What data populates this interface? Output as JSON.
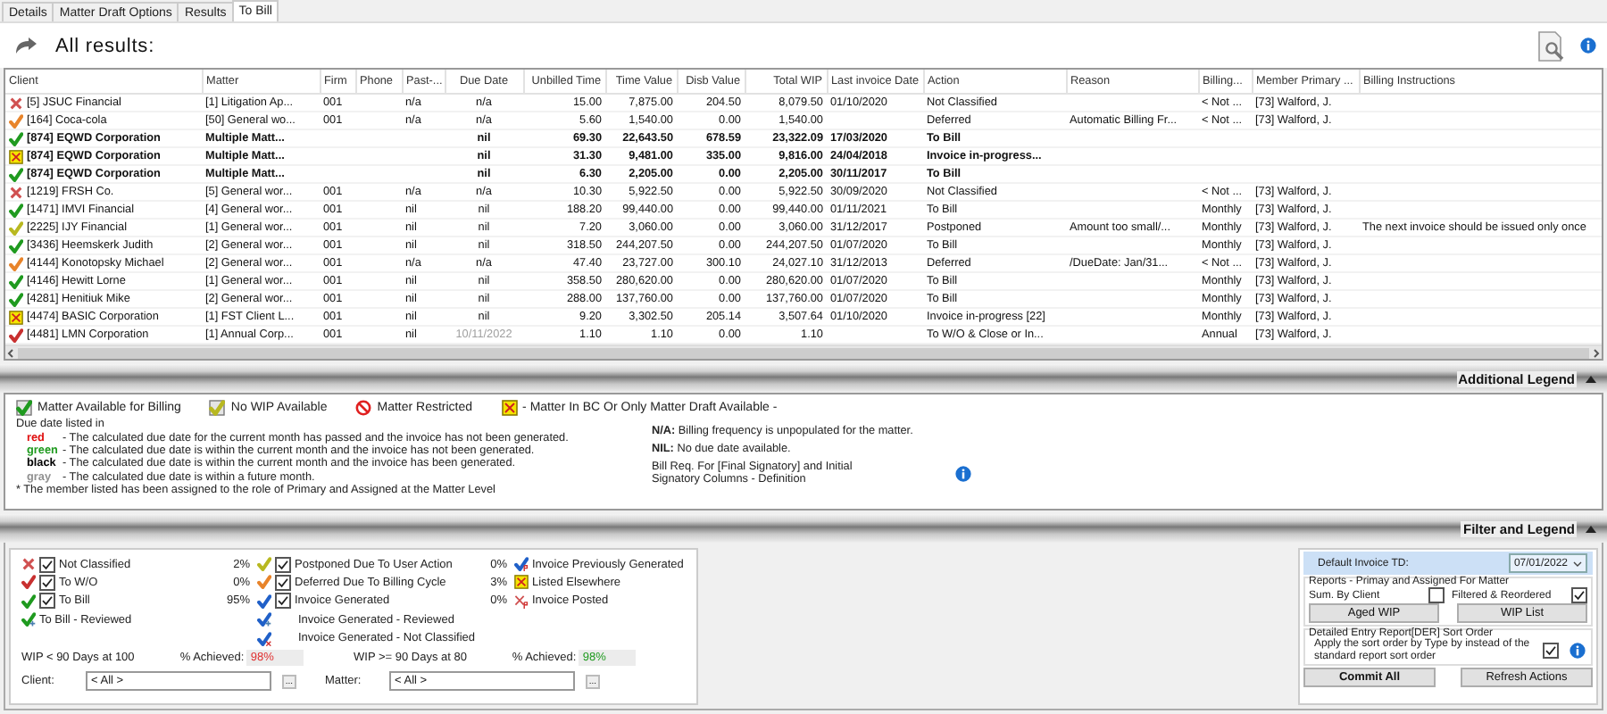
{
  "tabs": [
    {
      "label": "Details",
      "selected": false
    },
    {
      "label": "Matter Draft Options",
      "selected": false
    },
    {
      "label": "Results",
      "selected": false
    },
    {
      "label": "To Bill",
      "selected": true
    }
  ],
  "header": {
    "title": "All results:"
  },
  "table": {
    "columns": [
      "Client",
      "Matter",
      "Firm",
      "Phone",
      "Past-...",
      "Due Date",
      "Unbilled Time",
      "Time Value",
      "Disb Value",
      "Total WIP",
      "Last invoice Date",
      "Action",
      "Reason",
      "Billing...",
      "Member Primary ...",
      "Billing Instructions"
    ],
    "rows": [
      {
        "symbol": {
          "kind": "cross",
          "color": "#d05050"
        },
        "bold": false,
        "due_future": false,
        "cells": [
          "[5] JSUC Financial",
          "[1] Litigation Ap...",
          "001",
          null,
          "n/a",
          "n/a",
          "15.00",
          "7,875.00",
          "204.50",
          "8,079.50",
          "01/10/2020",
          "Not Classified",
          null,
          "< Not ...",
          "[73] Walford, J.",
          null
        ]
      },
      {
        "symbol": {
          "kind": "check",
          "color": "#e8842a"
        },
        "bold": false,
        "due_future": false,
        "cells": [
          "[164] Coca-cola",
          "[50] General wo...",
          "001",
          null,
          "n/a",
          "n/a",
          "5.60",
          "1,540.00",
          "0.00",
          "1,540.00",
          null,
          "Deferred",
          "Automatic Billing Fr...",
          "< Not ...",
          "[73] Walford, J.",
          null
        ]
      },
      {
        "symbol": {
          "kind": "check",
          "color": "#1f9a1f"
        },
        "bold": true,
        "due_future": false,
        "cells": [
          "[874] EQWD Corporation",
          "Multiple Matt...",
          null,
          null,
          null,
          "nil",
          "69.30",
          "22,643.50",
          "678.59",
          "23,322.09",
          "17/03/2020",
          "To Bill",
          null,
          null,
          null,
          null
        ]
      },
      {
        "symbol": {
          "kind": "boxed-cross",
          "color": "#f5e400"
        },
        "bold": true,
        "due_future": false,
        "cells": [
          "[874] EQWD Corporation",
          "Multiple Matt...",
          null,
          null,
          null,
          "nil",
          "31.30",
          "9,481.00",
          "335.00",
          "9,816.00",
          "24/04/2018",
          "Invoice in-progress...",
          null,
          null,
          null,
          null
        ]
      },
      {
        "symbol": {
          "kind": "check",
          "color": "#1f9a1f"
        },
        "bold": true,
        "due_future": false,
        "cells": [
          "[874] EQWD Corporation",
          "Multiple Matt...",
          null,
          null,
          null,
          "nil",
          "6.30",
          "2,205.00",
          "0.00",
          "2,205.00",
          "30/11/2017",
          "To Bill",
          null,
          null,
          null,
          null
        ]
      },
      {
        "symbol": {
          "kind": "cross",
          "color": "#d05050"
        },
        "bold": false,
        "due_future": false,
        "cells": [
          "[1219] FRSH Co.",
          "[5] General wor...",
          "001",
          null,
          "n/a",
          "n/a",
          "10.30",
          "5,922.50",
          "0.00",
          "5,922.50",
          "30/09/2020",
          "Not Classified",
          null,
          "< Not ...",
          "[73] Walford, J.",
          null
        ]
      },
      {
        "symbol": {
          "kind": "check",
          "color": "#1f9a1f"
        },
        "bold": false,
        "due_future": false,
        "cells": [
          "[1471] IMVI Financial",
          "[4] General wor...",
          "001",
          null,
          "nil",
          "nil",
          "188.20",
          "99,440.00",
          "0.00",
          "99,440.00",
          "01/11/2021",
          "To Bill",
          null,
          "Monthly",
          "[73] Walford, J.",
          null
        ]
      },
      {
        "symbol": {
          "kind": "check",
          "color": "#b8b820"
        },
        "bold": false,
        "due_future": false,
        "cells": [
          "[2225] IJY Financial",
          "[1] General wor...",
          "001",
          null,
          "nil",
          "nil",
          "7.20",
          "3,060.00",
          "0.00",
          "3,060.00",
          "31/12/2017",
          "Postponed",
          "Amount too small/...",
          "Monthly",
          "[73] Walford, J.",
          "The next invoice should be issued only once"
        ]
      },
      {
        "symbol": {
          "kind": "check",
          "color": "#1f9a1f"
        },
        "bold": false,
        "due_future": false,
        "cells": [
          "[3436] Heemskerk Judith",
          "[2] General wor...",
          "001",
          null,
          "nil",
          "nil",
          "318.50",
          "244,207.50",
          "0.00",
          "244,207.50",
          "01/07/2020",
          "To Bill",
          null,
          "Monthly",
          "[73] Walford, J.",
          null
        ]
      },
      {
        "symbol": {
          "kind": "check",
          "color": "#e8842a"
        },
        "bold": false,
        "due_future": false,
        "cells": [
          "[4144] Konotopsky Michael",
          "[2] General wor...",
          "001",
          null,
          "n/a",
          "n/a",
          "47.40",
          "23,727.00",
          "300.10",
          "24,027.10",
          "31/12/2013",
          "Deferred",
          "/DueDate: Jan/31...",
          "< Not ...",
          "[73] Walford, J.",
          null
        ]
      },
      {
        "symbol": {
          "kind": "check",
          "color": "#1f9a1f"
        },
        "bold": false,
        "due_future": false,
        "cells": [
          "[4146] Hewitt Lorne",
          "[1] General wor...",
          "001",
          null,
          "nil",
          "nil",
          "358.50",
          "280,620.00",
          "0.00",
          "280,620.00",
          "01/07/2020",
          "To Bill",
          null,
          "Monthly",
          "[73] Walford, J.",
          null
        ]
      },
      {
        "symbol": {
          "kind": "check",
          "color": "#1f9a1f"
        },
        "bold": false,
        "due_future": false,
        "cells": [
          "[4281] Henitiuk Mike",
          "[2] General wor...",
          "001",
          null,
          "nil",
          "nil",
          "288.00",
          "137,760.00",
          "0.00",
          "137,760.00",
          "01/07/2020",
          "To Bill",
          null,
          "Monthly",
          "[73] Walford, J.",
          null
        ]
      },
      {
        "symbol": {
          "kind": "boxed-cross",
          "color": "#f5e400"
        },
        "bold": false,
        "due_future": false,
        "cells": [
          "[4474] BASIC Corporation",
          "[1] FST Client L...",
          "001",
          null,
          "nil",
          "nil",
          "9.20",
          "3,302.50",
          "205.14",
          "3,507.64",
          "01/10/2020",
          "Invoice in-progress [22]",
          null,
          "Monthly",
          "[73] Walford, J.",
          null
        ]
      },
      {
        "symbol": {
          "kind": "check",
          "color": "#c83030"
        },
        "bold": false,
        "due_future": true,
        "cells": [
          "[4481] LMN Corporation",
          "[1] Annual Corp...",
          "001",
          null,
          "nil",
          "10/11/2022",
          "1.10",
          "1.10",
          "0.00",
          "1.10",
          null,
          "To W/O & Close or In...",
          null,
          "Annual",
          "[73] Walford, J.",
          null
        ]
      }
    ]
  },
  "additional_legend": {
    "title": "Additional Legend",
    "symbols": [
      {
        "kind": "boxed-check",
        "color": "#1f9a1f",
        "label": "Matter Available for Billing"
      },
      {
        "kind": "boxed-check",
        "color": "#b8b820",
        "label": "No WIP Available"
      },
      {
        "kind": "no-entry",
        "color": "#e02020",
        "label": "Matter Restricted"
      },
      {
        "kind": "boxed-cross",
        "color": "#f5e400",
        "label": "- Matter In BC Or Only Matter Draft Available -"
      }
    ],
    "due_intro": "Due date listed in",
    "due_colors": [
      {
        "word": "red",
        "color": "#e01010",
        "text": "- The calculated due date for the current month has passed and the invoice has not been generated."
      },
      {
        "word": "green",
        "color": "#1f9a1f",
        "text": "- The calculated due date is within the current month and the invoice has not been generated."
      },
      {
        "word": "black",
        "color": "#000000",
        "text": "- The calculated due date is within the current month and the invoice has been generated."
      },
      {
        "word": "gray",
        "color": "#909090",
        "text": "- The calculated due date is within a future month."
      }
    ],
    "footnote": "* The member listed has been assigned to the role of Primary and Assigned  at the Matter Level",
    "notes": [
      "**N/A:** Billing frequency is unpopulated for the matter.",
      "**NIL:**  No due date available."
    ],
    "definition": "Bill Req. For [Final Signatory] and Initial Signatory Columns - Definition"
  },
  "filter_legend": {
    "title": "Filter and Legend",
    "status_columns": [
      [
        {
          "label": "Not Classified",
          "symbol": {
            "kind": "cross",
            "color": "#d05050"
          },
          "checkbox": {
            "checked": true
          },
          "pct": "2%"
        },
        {
          "label": "To W/O",
          "symbol": {
            "kind": "check",
            "color": "#c83030"
          },
          "checkbox": {
            "checked": true
          },
          "pct": "0%"
        },
        {
          "label": "To Bill",
          "symbol": {
            "kind": "check",
            "color": "#1f9a1f"
          },
          "checkbox": {
            "checked": true
          },
          "pct": "95%"
        },
        {
          "label": "To Bill - Reviewed",
          "symbol": {
            "kind": "check-plus",
            "color": "#1f9a1f"
          }
        }
      ],
      [
        {
          "label": "Postponed Due To User Action",
          "symbol": {
            "kind": "check",
            "color": "#b8b820"
          },
          "checkbox": {
            "checked": true
          },
          "pct": "0%"
        },
        {
          "label": "Deferred Due To Billing Cycle",
          "symbol": {
            "kind": "check",
            "color": "#e8842a"
          },
          "checkbox": {
            "checked": true
          },
          "pct": "3%"
        },
        {
          "label": "Invoice Generated",
          "symbol": {
            "kind": "check",
            "color": "#2060c8"
          },
          "checkbox": {
            "checked": true
          },
          "pct": "0%"
        },
        {
          "label": "Invoice Generated - Reviewed",
          "symbol": {
            "kind": "check-plus",
            "color": "#2060c8"
          }
        },
        {
          "label": "Invoice Generated - Not Classified",
          "symbol": {
            "kind": "check-x",
            "color": "#2060c8"
          }
        }
      ],
      [
        {
          "label": "Invoice Previously Generated",
          "symbol": {
            "kind": "check-badge",
            "color": "#2060c8"
          }
        },
        {
          "label": "Listed Elsewhere",
          "symbol": {
            "kind": "boxed-cross",
            "color": "#f5e400"
          }
        },
        {
          "label": "Invoice Posted",
          "symbol": {
            "kind": "cross-badge",
            "color": "#d05050"
          }
        }
      ]
    ],
    "targets": [
      {
        "label": "WIP < 90  Days at 100",
        "achieved_label": "% Achieved:",
        "achieved": "98%",
        "color": "#e03030"
      },
      {
        "label": "WIP >= 90  Days at 80",
        "achieved_label": "% Achieved:",
        "achieved": "98%",
        "color": "#1f9a1f"
      }
    ],
    "lookups": [
      {
        "label": "Client:",
        "value": "< All >",
        "button": "..."
      },
      {
        "label": "Matter:",
        "value": "< All >",
        "button": "..."
      }
    ],
    "invoice": {
      "label": "Default Invoice TD:",
      "value": "07/01/2022"
    },
    "reports": {
      "title": "Reports - Primay and Assigned  For  Matter",
      "options": [
        {
          "label": "Sum. By Client",
          "checked": false
        },
        {
          "label": "Filtered & Reordered",
          "checked": true
        }
      ],
      "buttons": [
        "Aged WIP",
        "WIP List"
      ]
    },
    "sort": {
      "title": "Detailed Entry Report[DER] Sort Order",
      "text": "Apply the sort order by Type by instead of the standard report sort order",
      "checked": true
    },
    "actions": [
      {
        "label": "Commit All",
        "kind": "primary"
      },
      {
        "label": "Refresh Actions",
        "kind": "normal"
      }
    ]
  }
}
